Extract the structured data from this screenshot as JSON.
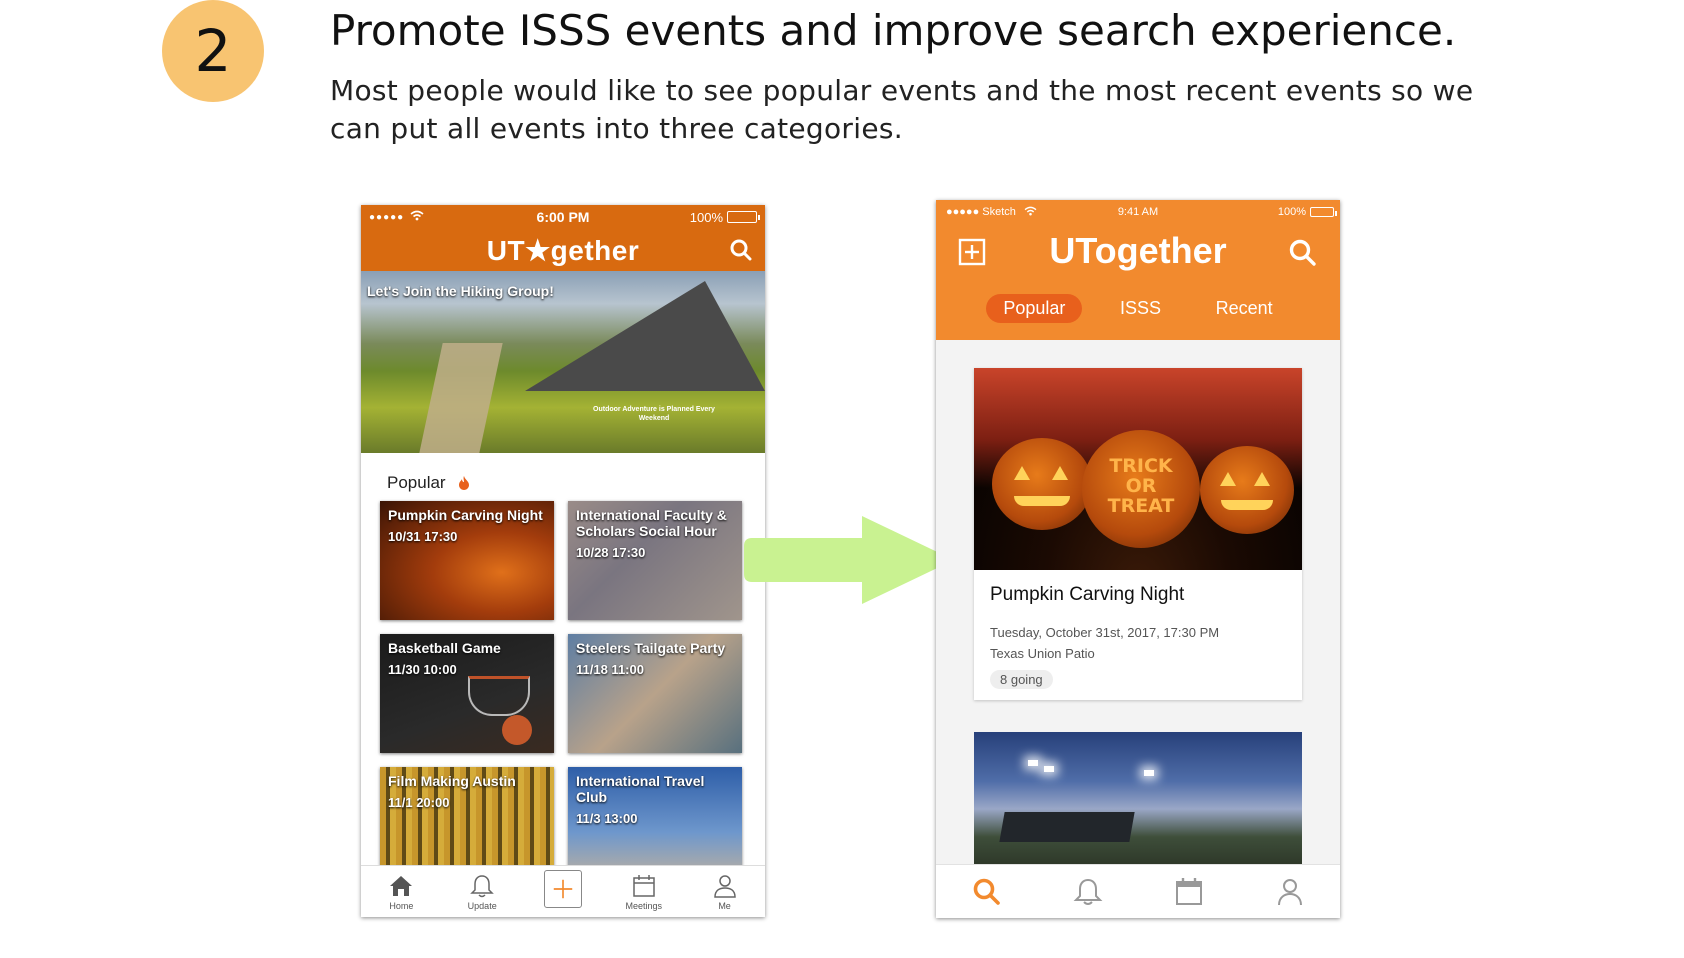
{
  "step": {
    "number": "2",
    "title": "Promote ISSS events and improve search experience.",
    "description": "Most people would like to see popular events and the most recent events so we can put all events into three categories."
  },
  "colors": {
    "badge": "#f8c471",
    "left_orange": "#d86a10",
    "right_orange": "#f28a2e",
    "arrow": "#c9f291"
  },
  "left_phone": {
    "status": {
      "signal": "●●●●●",
      "time": "6:00 PM",
      "battery": "100%"
    },
    "logo": "UT★gether",
    "hero": {
      "caption": "Let's Join the Hiking Group!",
      "tagline": "Outdoor Adventure is Planned Every Weekend"
    },
    "section_label": "Popular",
    "tiles": [
      {
        "title": "Pumpkin Carving Night",
        "date": "10/31 17:30"
      },
      {
        "title": "International Faculty & Scholars Social Hour",
        "date": "10/28 17:30"
      },
      {
        "title": "Basketball Game",
        "date": "11/30 10:00"
      },
      {
        "title": "Steelers Tailgate Party",
        "date": "11/18 11:00"
      },
      {
        "title": "Film Making Austin",
        "date": "11/1 20:00"
      },
      {
        "title": "International Travel Club",
        "date": "11/3 13:00"
      }
    ],
    "tabbar": {
      "home": "Home",
      "update": "Update",
      "meetings": "Meetings",
      "me": "Me"
    }
  },
  "right_phone": {
    "status": {
      "carrier": "●●●●● Sketch",
      "time": "9:41 AM",
      "battery": "100%"
    },
    "logo": "UTogether",
    "tabs": [
      "Popular",
      "ISSS",
      "Recent"
    ],
    "active_tab": "Popular",
    "event": {
      "title": "Pumpkin Carving Night",
      "datetime": "Tuesday, October 31st, 2017, 17:30 PM",
      "location": "Texas Union Patio",
      "going": "8 going"
    },
    "pumpkin_carving": [
      "TRICK",
      "OR",
      "TREAT"
    ]
  }
}
